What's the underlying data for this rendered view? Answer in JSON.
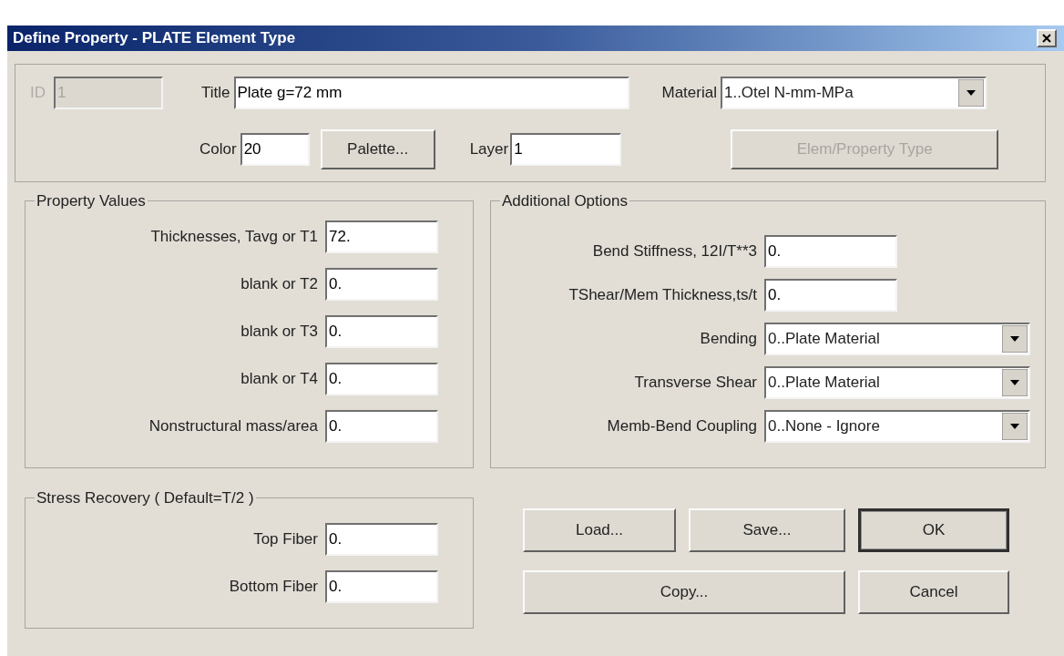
{
  "window": {
    "title": "Define Property - PLATE Element Type"
  },
  "header": {
    "id": {
      "label": "ID",
      "value": "1",
      "disabled": true
    },
    "title": {
      "label": "Title",
      "value": "Plate g=72 mm"
    },
    "material": {
      "label": "Material",
      "value": "1..Otel N-mm-MPa"
    },
    "color": {
      "label": "Color",
      "value": "20"
    },
    "palette_button": {
      "label": "Palette...",
      "disabled": false
    },
    "layer": {
      "label": "Layer",
      "value": "1"
    },
    "type_button": {
      "label": "Elem/Property Type",
      "disabled": true
    }
  },
  "property_values": {
    "title": "Property Values",
    "fields": [
      {
        "label": "Thicknesses, Tavg or T1",
        "value": "72."
      },
      {
        "label": "blank or T2",
        "value": "0."
      },
      {
        "label": "blank or T3",
        "value": "0."
      },
      {
        "label": "blank or T4",
        "value": "0."
      },
      {
        "label": "Nonstructural mass/area",
        "value": "0."
      }
    ]
  },
  "additional_options": {
    "title": "Additional Options",
    "fields": [
      {
        "kind": "text",
        "label": "Bend Stiffness, 12I/T**3",
        "value": "0."
      },
      {
        "kind": "text",
        "label": "TShear/Mem Thickness,ts/t",
        "value": "0."
      },
      {
        "kind": "select",
        "label": "Bending",
        "value": "0..Plate Material"
      },
      {
        "kind": "select",
        "label": "Transverse Shear",
        "value": "0..Plate Material"
      },
      {
        "kind": "select",
        "label": "Memb-Bend Coupling",
        "value": "0..None - Ignore"
      }
    ]
  },
  "stress_recovery": {
    "title": "Stress Recovery ( Default=T/2 )",
    "fields": [
      {
        "label": "Top Fiber",
        "value": "0."
      },
      {
        "label": "Bottom Fiber",
        "value": "0."
      }
    ]
  },
  "buttons": [
    {
      "label": "Load...",
      "default": false,
      "wide": false
    },
    {
      "label": "Save...",
      "default": false,
      "wide": false
    },
    {
      "label": "OK",
      "default": true,
      "wide": false
    },
    {
      "label": "Copy...",
      "default": false,
      "wide": true
    },
    {
      "label": "Cancel",
      "default": false,
      "wide": false
    }
  ]
}
